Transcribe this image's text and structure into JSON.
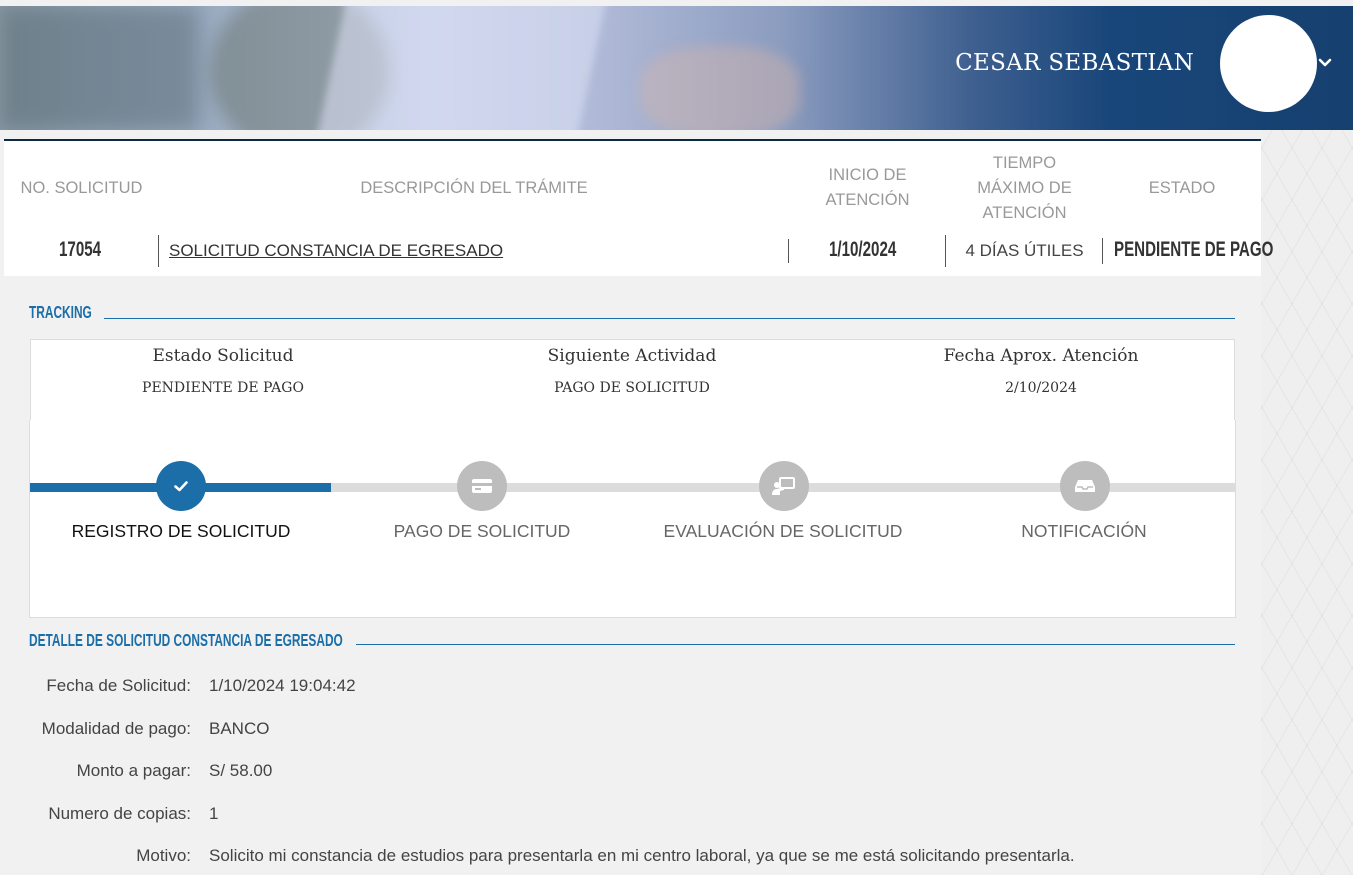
{
  "header": {
    "user_name": "CESAR SEBASTIAN"
  },
  "request_table": {
    "columns": {
      "number": "NO. SOLICITUD",
      "description": "DESCRIPCIÓN DEL TRÁMITE",
      "start_line1": "INICIO DE",
      "start_line2": "ATENCIÓN",
      "max_line1": "TIEMPO",
      "max_line2": "MÁXIMO DE",
      "max_line3": "ATENCIÓN",
      "status": "ESTADO"
    },
    "row": {
      "number": "17054",
      "description": "SOLICITUD CONSTANCIA DE EGRESADO",
      "start": "1/10/2024",
      "max_time": "4 DÍAS ÚTILES",
      "status": "PENDIENTE DE PAGO"
    }
  },
  "tracking": {
    "title": "TRACKING",
    "info": [
      {
        "label": "Estado Solicitud",
        "value": "PENDIENTE DE PAGO"
      },
      {
        "label": "Siguiente Actividad",
        "value": "PAGO DE SOLICITUD"
      },
      {
        "label": "Fecha Aprox. Atención",
        "value": "2/10/2024"
      }
    ],
    "progress_fraction": 0.25,
    "steps": [
      {
        "label": "REGISTRO DE SOLICITUD",
        "icon": "check-icon",
        "done": true
      },
      {
        "label": "PAGO DE SOLICITUD",
        "icon": "credit-card-icon",
        "done": false
      },
      {
        "label": "EVALUACIÓN DE SOLICITUD",
        "icon": "presentation-icon",
        "done": false
      },
      {
        "label": "NOTIFICACIÓN",
        "icon": "inbox-icon",
        "done": false
      }
    ]
  },
  "detail": {
    "title": "DETALLE DE SOLICITUD CONSTANCIA DE EGRESADO",
    "fields": [
      {
        "label": "Fecha de Solicitud:",
        "value": "1/10/2024 19:04:42"
      },
      {
        "label": "Modalidad de pago:",
        "value": "BANCO"
      },
      {
        "label": "Monto a pagar:",
        "value": "S/ 58.00"
      },
      {
        "label": "Numero de copias:",
        "value": "1"
      },
      {
        "label": "Motivo:",
        "value": "Solicito mi constancia de estudios para presentarla en mi centro laboral, ya que se me está solicitando presentarla."
      }
    ]
  },
  "colors": {
    "accent": "#1b6ea8",
    "header_dark": "#15406f",
    "step_pending": "#bdbdbd"
  }
}
